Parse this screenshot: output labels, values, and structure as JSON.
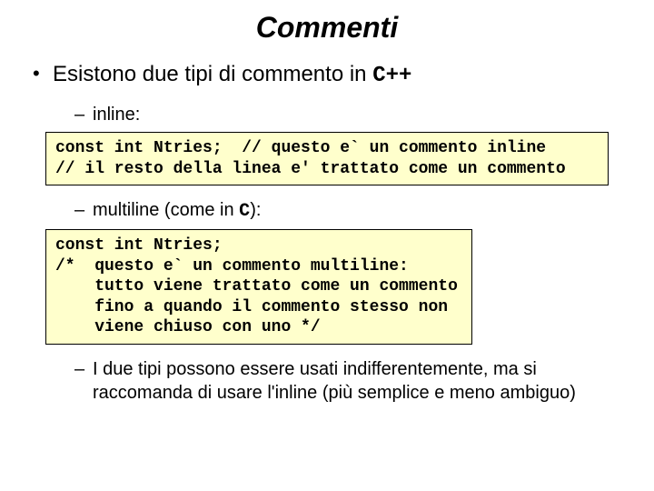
{
  "title": "Commenti",
  "bullet1_prefix": "Esistono due tipi di commento in ",
  "bullet1_cpp": "C++",
  "sub_inline": "inline:",
  "code1": "const int Ntries;  // questo e` un commento inline\n// il resto della linea e' trattato come un commento",
  "sub_multiline_prefix": "multiline (come in ",
  "sub_multiline_c": "C",
  "sub_multiline_suffix": "):",
  "code2": "const int Ntries;\n/*  questo e` un commento multiline:\n    tutto viene trattato come un commento\n    fino a quando il commento stesso non\n    viene chiuso con uno */",
  "sub_note": "I due tipi possono essere usati indifferentemente, ma si raccomanda di usare l'inline (più semplice e meno ambiguo)"
}
